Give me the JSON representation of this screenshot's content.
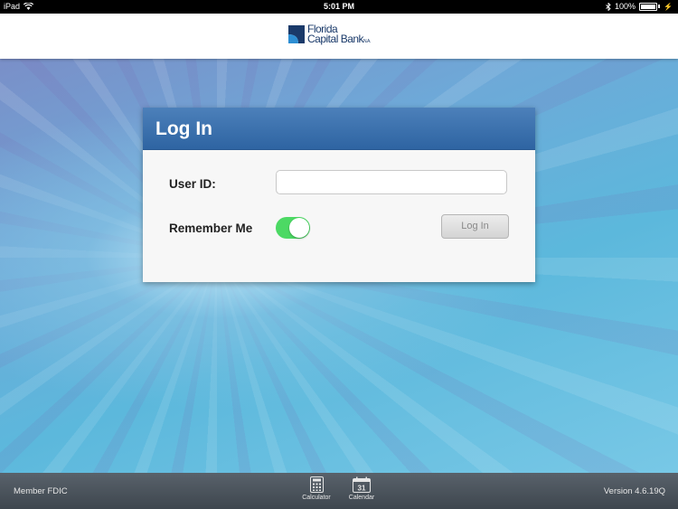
{
  "status_bar": {
    "device": "iPad",
    "time": "5:01 PM",
    "battery": "100%"
  },
  "header": {
    "logo_line1": "Florida",
    "logo_line2": "Capital Bank",
    "logo_suffix": "N.A."
  },
  "login": {
    "title": "Log In",
    "user_id_label": "User ID:",
    "user_id_value": "",
    "remember_label": "Remember Me",
    "remember_on": true,
    "button_label": "Log In"
  },
  "footer": {
    "member": "Member FDIC",
    "tools": [
      {
        "label": "Calculator",
        "icon": "calculator-icon"
      },
      {
        "label": "Calendar",
        "icon": "calendar-icon",
        "day": "31"
      }
    ],
    "version": "Version 4.6.19Q"
  },
  "colors": {
    "panel_header": "#3a6eaf",
    "toggle_on": "#4cd964",
    "logo": "#1a3a6a"
  }
}
